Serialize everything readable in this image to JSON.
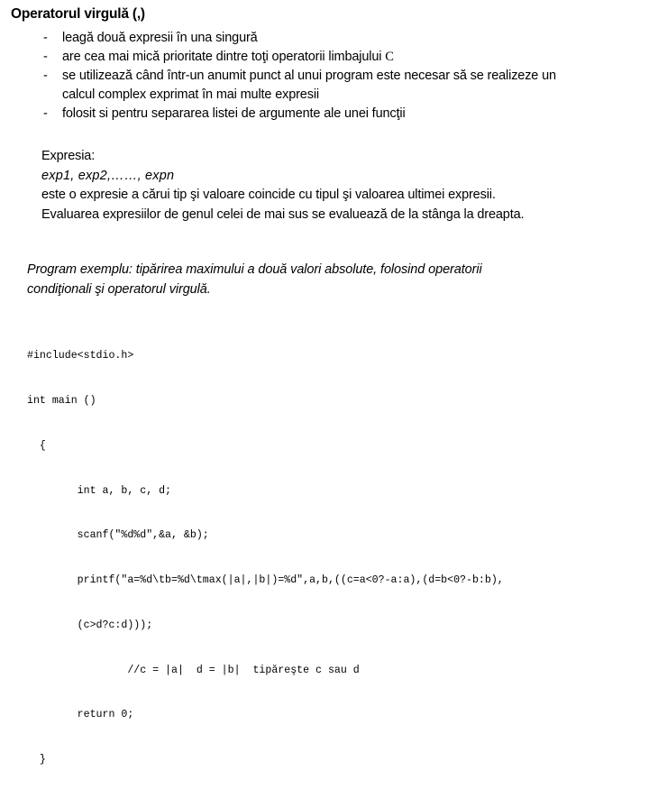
{
  "page": {
    "background_color": "#ffffff",
    "text_color": "#000000"
  },
  "heading": "Operatorul virgulă (,)",
  "bullets": {
    "marker": "-",
    "items": [
      {
        "text": "leagă două expresii în una singură",
        "continuation": ""
      },
      {
        "text": "are cea mai mică prioritate dintre toţi operatorii limbajului ",
        "trailing_mono": "C",
        "continuation": ""
      },
      {
        "text": "se utilizează când într-un anumit punct al unui program este necesar să se realizeze un",
        "continuation": "calcul complex exprimat în mai multe expresii"
      },
      {
        "text": "folosit si pentru separarea listei de argumente ale unei funcţii",
        "continuation": ""
      }
    ]
  },
  "expression_block": {
    "label": "Expresia:",
    "formula": "exp1, exp2,……, expn",
    "line1": "este o expresie a cărui tip şi valoare coincide cu tipul şi valoarea ultimei expresii.",
    "line2": "Evaluarea expresiilor de genul celei de mai sus se evaluează de la stânga la dreapta."
  },
  "program_note": {
    "line1": "Program exemplu: tipărirea maximului a două valori absolute, folosind operatorii",
    "line2": "condiţionali şi operatorul virgulă."
  },
  "code": {
    "lines": [
      "#include<stdio.h>",
      "int main ()",
      "  {",
      "        int a, b, c, d;",
      "        scanf(\"%d%d\",&a, &b);",
      "        printf(\"a=%d\\tb=%d\\tmax(|a|,|b|)=%d\",a,b,((c=a<0?-a:a),(d=b<0?-b:b),",
      "        (c>d?c:d)));",
      "                //c = |a|  d = |b|  tipăreşte c sau d",
      "        return 0;",
      "  }"
    ]
  }
}
